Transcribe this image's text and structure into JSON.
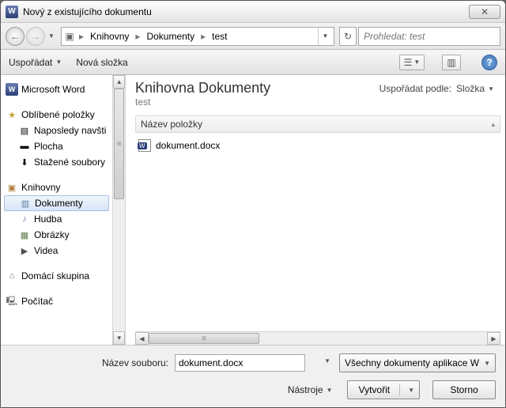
{
  "window": {
    "title": "Nový z existujícího dokumentu"
  },
  "breadcrumb": {
    "items": [
      "Knihovny",
      "Dokumenty",
      "test"
    ]
  },
  "search": {
    "placeholder": "Prohledat: test"
  },
  "toolbar": {
    "organize": "Uspořádat",
    "newfolder": "Nová složka"
  },
  "sidebar": {
    "ms_word": "Microsoft Word",
    "favorites": "Oblíbené položky",
    "fav_items": [
      "Naposledy navšti",
      "Plocha",
      "Stažené soubory"
    ],
    "libraries": "Knihovny",
    "lib_items": [
      "Dokumenty",
      "Hudba",
      "Obrázky",
      "Videa"
    ],
    "homegroup": "Domácí skupina",
    "computer": "Počítač"
  },
  "main": {
    "lib_title": "Knihovna Dokumenty",
    "lib_sub": "test",
    "arrange_label": "Uspořádat podle:",
    "arrange_value": "Složka",
    "column_header": "Název položky",
    "files": [
      "dokument.docx"
    ]
  },
  "footer": {
    "filename_label": "Název souboru:",
    "filename_value": "dokument.docx",
    "filter": "Všechny dokumenty aplikace W",
    "tools": "Nástroje",
    "open": "Vytvořit",
    "cancel": "Storno"
  }
}
